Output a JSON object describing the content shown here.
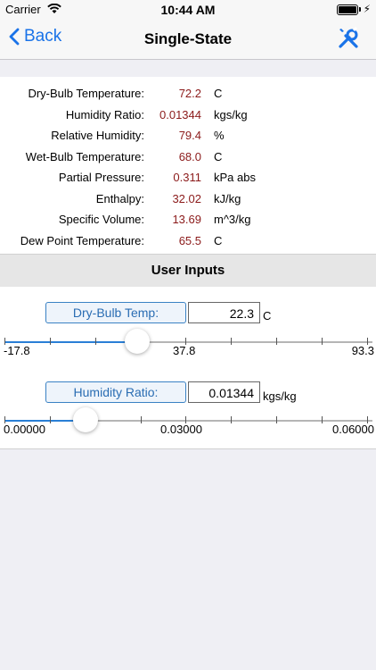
{
  "status": {
    "carrier": "Carrier",
    "time": "10:44 AM"
  },
  "nav": {
    "back_label": "Back",
    "title": "Single-State"
  },
  "results": [
    {
      "label": "Dry-Bulb Temperature:",
      "value": "72.2",
      "unit": "C"
    },
    {
      "label": "Humidity Ratio:",
      "value": "0.01344",
      "unit": "kgs/kg"
    },
    {
      "label": "Relative Humidity:",
      "value": "79.4",
      "unit": "%"
    },
    {
      "label": "Wet-Bulb Temperature:",
      "value": "68.0",
      "unit": "C"
    },
    {
      "label": "Partial Pressure:",
      "value": "0.311",
      "unit": "kPa abs"
    },
    {
      "label": "Enthalpy:",
      "value": "32.02",
      "unit": "kJ/kg"
    },
    {
      "label": "Specific Volume:",
      "value": "13.69",
      "unit": "m^3/kg"
    },
    {
      "label": "Dew Point Temperature:",
      "value": "65.5",
      "unit": "C"
    }
  ],
  "user_inputs": {
    "header": "User Inputs",
    "dry_bulb": {
      "button": "Dry-Bulb Temp:",
      "value": "22.3",
      "unit": "C",
      "min": "-17.8",
      "mid": "37.8",
      "max": "93.3",
      "slider_fraction": 0.36
    },
    "humidity": {
      "button": "Humidity Ratio:",
      "value": "0.01344",
      "unit": "kgs/kg",
      "min": "0.00000",
      "mid": "0.03000",
      "max": "0.06000",
      "slider_fraction": 0.22
    }
  },
  "colors": {
    "accent": "#2a7fd6",
    "value_text": "#8b1a1a"
  }
}
